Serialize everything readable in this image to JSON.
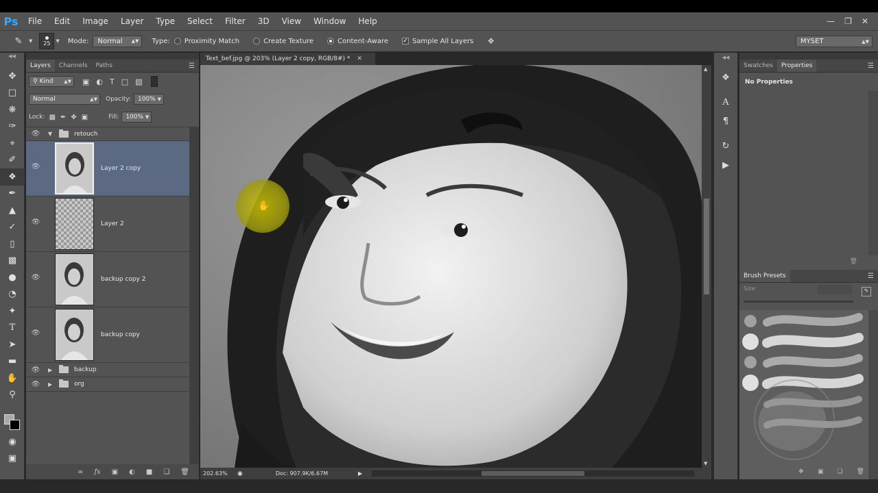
{
  "app": {
    "logo": "Ps",
    "menu": [
      "File",
      "Edit",
      "Image",
      "Layer",
      "Type",
      "Select",
      "Filter",
      "3D",
      "View",
      "Window",
      "Help"
    ],
    "window_controls": [
      "minimize-icon",
      "restore-icon",
      "close-icon"
    ]
  },
  "options": {
    "brush_size": "25",
    "mode_label": "Mode:",
    "mode_value": "Normal",
    "type_label": "Type:",
    "type_options": [
      {
        "label": "Proximity Match",
        "selected": false
      },
      {
        "label": "Create Texture",
        "selected": false
      },
      {
        "label": "Content-Aware",
        "selected": true
      }
    ],
    "sample_all_layers": {
      "label": "Sample All Layers",
      "checked": true
    },
    "workspace": "MYSET"
  },
  "tools": [
    "move-icon",
    "marquee-icon",
    "lasso-icon",
    "quick-select-icon",
    "crop-icon",
    "eyedropper-icon",
    "spot-healing-icon",
    "brush-icon",
    "clone-stamp-icon",
    "history-brush-icon",
    "eraser-icon",
    "gradient-icon",
    "blur-icon",
    "dodge-icon",
    "pen-icon",
    "type-icon",
    "path-select-icon",
    "rectangle-icon",
    "hand-icon",
    "zoom-icon"
  ],
  "layers_panel": {
    "tabs": [
      "Layers",
      "Channels",
      "Paths"
    ],
    "active_tab": "Layers",
    "filter_kind": "Kind",
    "blend_mode": "Normal",
    "opacity_label": "Opacity:",
    "opacity": "100%",
    "lock_label": "Lock:",
    "fill_label": "Fill:",
    "fill": "100%",
    "group_retouch": "retouch",
    "layers": [
      {
        "name": "Layer 2 copy",
        "selected": true,
        "thumb": "photo"
      },
      {
        "name": "Layer 2",
        "selected": false,
        "thumb": "transparent"
      },
      {
        "name": "backup copy 2",
        "selected": false,
        "thumb": "photo"
      },
      {
        "name": "backup copy",
        "selected": false,
        "thumb": "photo"
      }
    ],
    "groups_collapsed": [
      "backup",
      "org"
    ]
  },
  "document": {
    "tab_title": "Text_bef.jpg @ 203% (Layer 2 copy, RGB/8#) *",
    "zoom": "202.63%",
    "doc_size": "Doc: 907.9K/6.67M"
  },
  "right_panel": {
    "tabs": [
      "Swatches",
      "Properties"
    ],
    "active_tab": "Properties",
    "properties_text": "No Properties",
    "brush_presets_tab": "Brush Presets",
    "size_label": "Size:"
  },
  "colors": {
    "ui_bg": "#535353",
    "selected_layer": "#5b6983",
    "brush_cursor": "#c9c200"
  }
}
